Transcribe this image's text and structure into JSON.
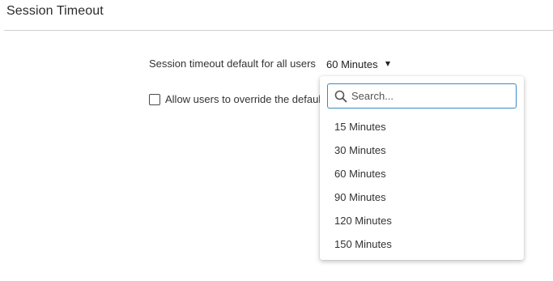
{
  "section": {
    "title": "Session Timeout"
  },
  "timeout": {
    "label": "Session timeout default for all users",
    "selected": "60 Minutes"
  },
  "override": {
    "label": "Allow users to override the default",
    "checked": false
  },
  "dropdown": {
    "search_placeholder": "Search...",
    "options": [
      {
        "label": "15 Minutes"
      },
      {
        "label": "30 Minutes"
      },
      {
        "label": "60 Minutes"
      },
      {
        "label": "90 Minutes"
      },
      {
        "label": "120 Minutes"
      },
      {
        "label": "150 Minutes"
      }
    ]
  },
  "colors": {
    "search_border": "#3a8bc4",
    "divider": "#cfcfcf"
  },
  "icons": {
    "search": "search-icon",
    "caret": "caret-down-icon"
  }
}
